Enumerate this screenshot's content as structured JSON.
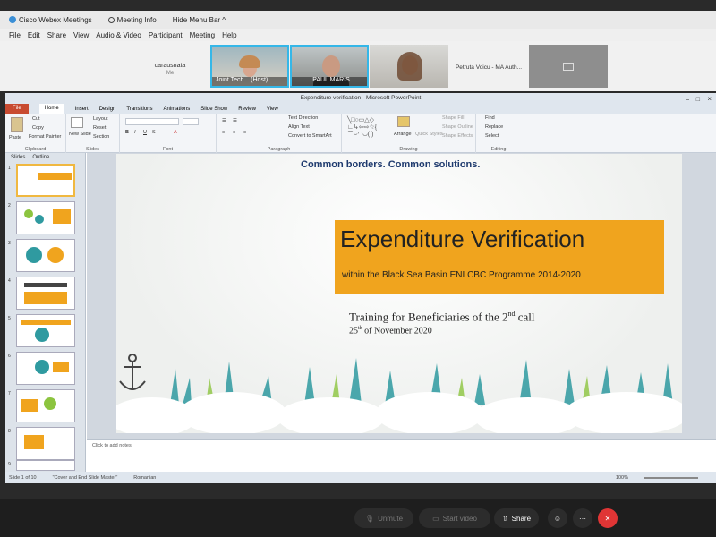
{
  "webex": {
    "app_title": "Cisco Webex Meetings",
    "meeting_info": "Meeting Info",
    "hide_menu_bar": "Hide Menu Bar ^",
    "menu": [
      "File",
      "Edit",
      "Share",
      "View",
      "Audio & Video",
      "Participant",
      "Meeting",
      "Help"
    ],
    "participants": [
      {
        "name": "carausnata",
        "sub": "Me"
      },
      {
        "name": "Joint Tech... (Host)"
      },
      {
        "name": "PAUL MARIS"
      },
      {
        "name": ""
      },
      {
        "name": "Petruta Voicu - MA Auth..."
      }
    ],
    "controls": {
      "unmute": "Unmute",
      "start_video": "Start video",
      "share": "Share",
      "more": "···"
    }
  },
  "ppt": {
    "window_title": "Expenditure verification - Microsoft PowerPoint",
    "tabs": [
      "File",
      "Home",
      "Insert",
      "Design",
      "Transitions",
      "Animations",
      "Slide Show",
      "Review",
      "View"
    ],
    "ribbon": {
      "clipboard": {
        "paste": "Paste",
        "cut": "Cut",
        "copy": "Copy",
        "format_painter": "Format Painter",
        "label": "Clipboard"
      },
      "slides": {
        "new_slide": "New Slide",
        "layout": "Layout",
        "reset": "Reset",
        "section": "Section",
        "label": "Slides"
      },
      "font": {
        "label": "Font"
      },
      "paragraph": {
        "label": "Paragraph",
        "text_direction": "Text Direction",
        "align_text": "Align Text",
        "convert": "Convert to SmartArt"
      },
      "drawing": {
        "label": "Drawing",
        "arrange": "Arrange",
        "quick_styles": "Quick Styles",
        "shape_fill": "Shape Fill",
        "shape_outline": "Shape Outline",
        "shape_effects": "Shape Effects"
      },
      "editing": {
        "label": "Editing",
        "find": "Find",
        "replace": "Replace",
        "select": "Select"
      }
    },
    "panel_tabs": [
      "Slides",
      "Outline"
    ],
    "thumb_numbers": [
      "1",
      "2",
      "3",
      "4",
      "5",
      "6",
      "7",
      "8",
      "9"
    ],
    "slide": {
      "header": "Common borders. Common solutions.",
      "title": "Expenditure Verification",
      "subtitle": "within the Black Sea Basin ENI CBC Programme 2014-2020",
      "training": "Training for Beneficiaries of the 2",
      "training_sup": "nd",
      "training_end": " call",
      "date_day": "25",
      "date_sup": "th",
      "date_rest": " of November 2020"
    },
    "notes_placeholder": "Click to add notes",
    "status": {
      "slide": "Slide 1 of 10",
      "theme": "\"Cover and End Slide Master\"",
      "language": "Romanian",
      "zoom": "100%"
    },
    "colors": {
      "title_box": "#f0a41e",
      "accent": "#2f9aa0"
    }
  }
}
